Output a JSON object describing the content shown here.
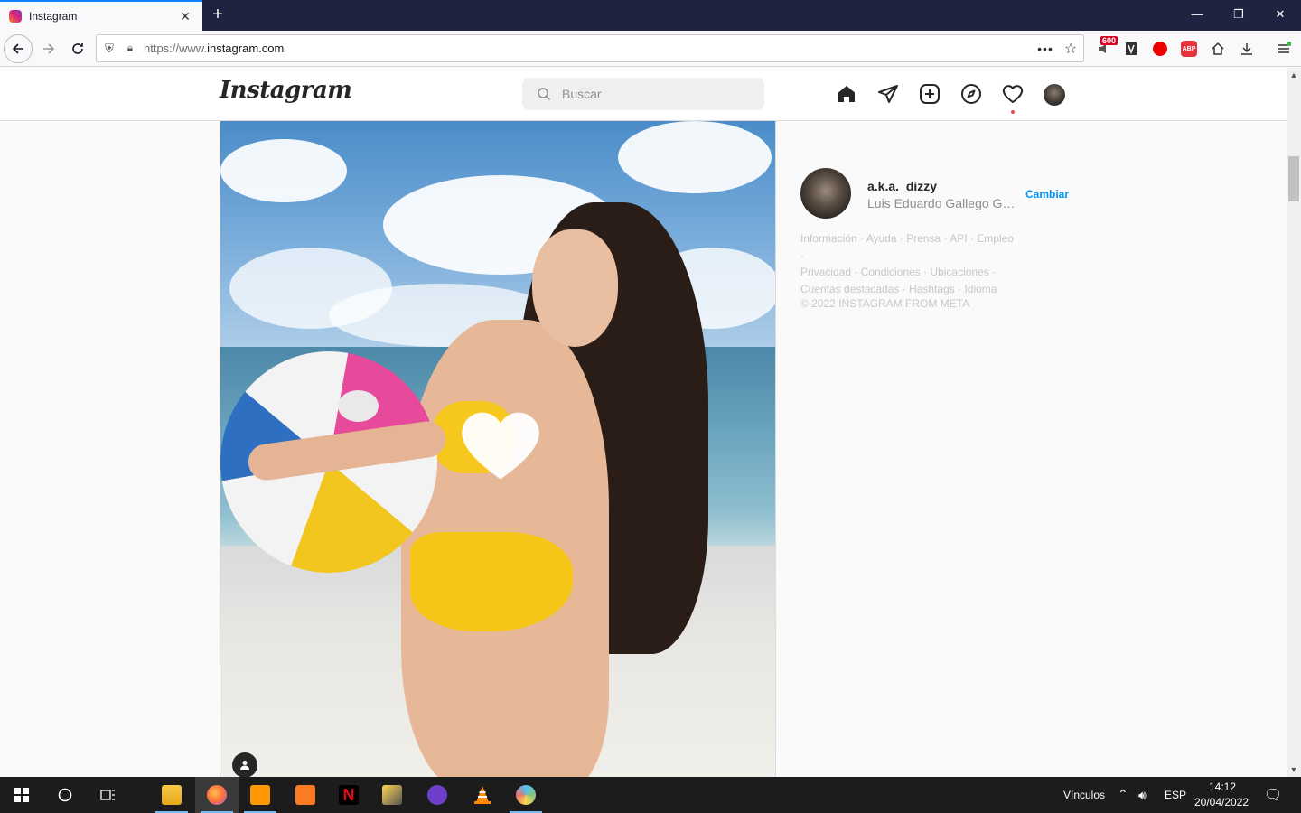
{
  "browser": {
    "tab_title": "Instagram",
    "url_prefix": "https://www.",
    "url_domain": "instagram.com",
    "badge_count": "600"
  },
  "instagram": {
    "logo": "Instagram",
    "search_placeholder": "Buscar",
    "profile": {
      "username": "a.k.a._dizzy",
      "full_name": "Luis Eduardo Gallego Gar...",
      "switch_label": "Cambiar"
    },
    "footer_links": [
      "Información",
      "Ayuda",
      "Prensa",
      "API",
      "Empleo",
      "Privacidad",
      "Condiciones",
      "Ubicaciones",
      "Cuentas destacadas",
      "Hashtags",
      "Idioma"
    ],
    "copyright": "© 2022 INSTAGRAM FROM META"
  },
  "taskbar": {
    "links_label": "Vínculos",
    "language": "ESP",
    "time": "14:12",
    "date": "20/04/2022"
  },
  "colors": {
    "accent_blue": "#0095f6",
    "notification_red": "#ed4956",
    "tab_strip": "#1f2340"
  }
}
